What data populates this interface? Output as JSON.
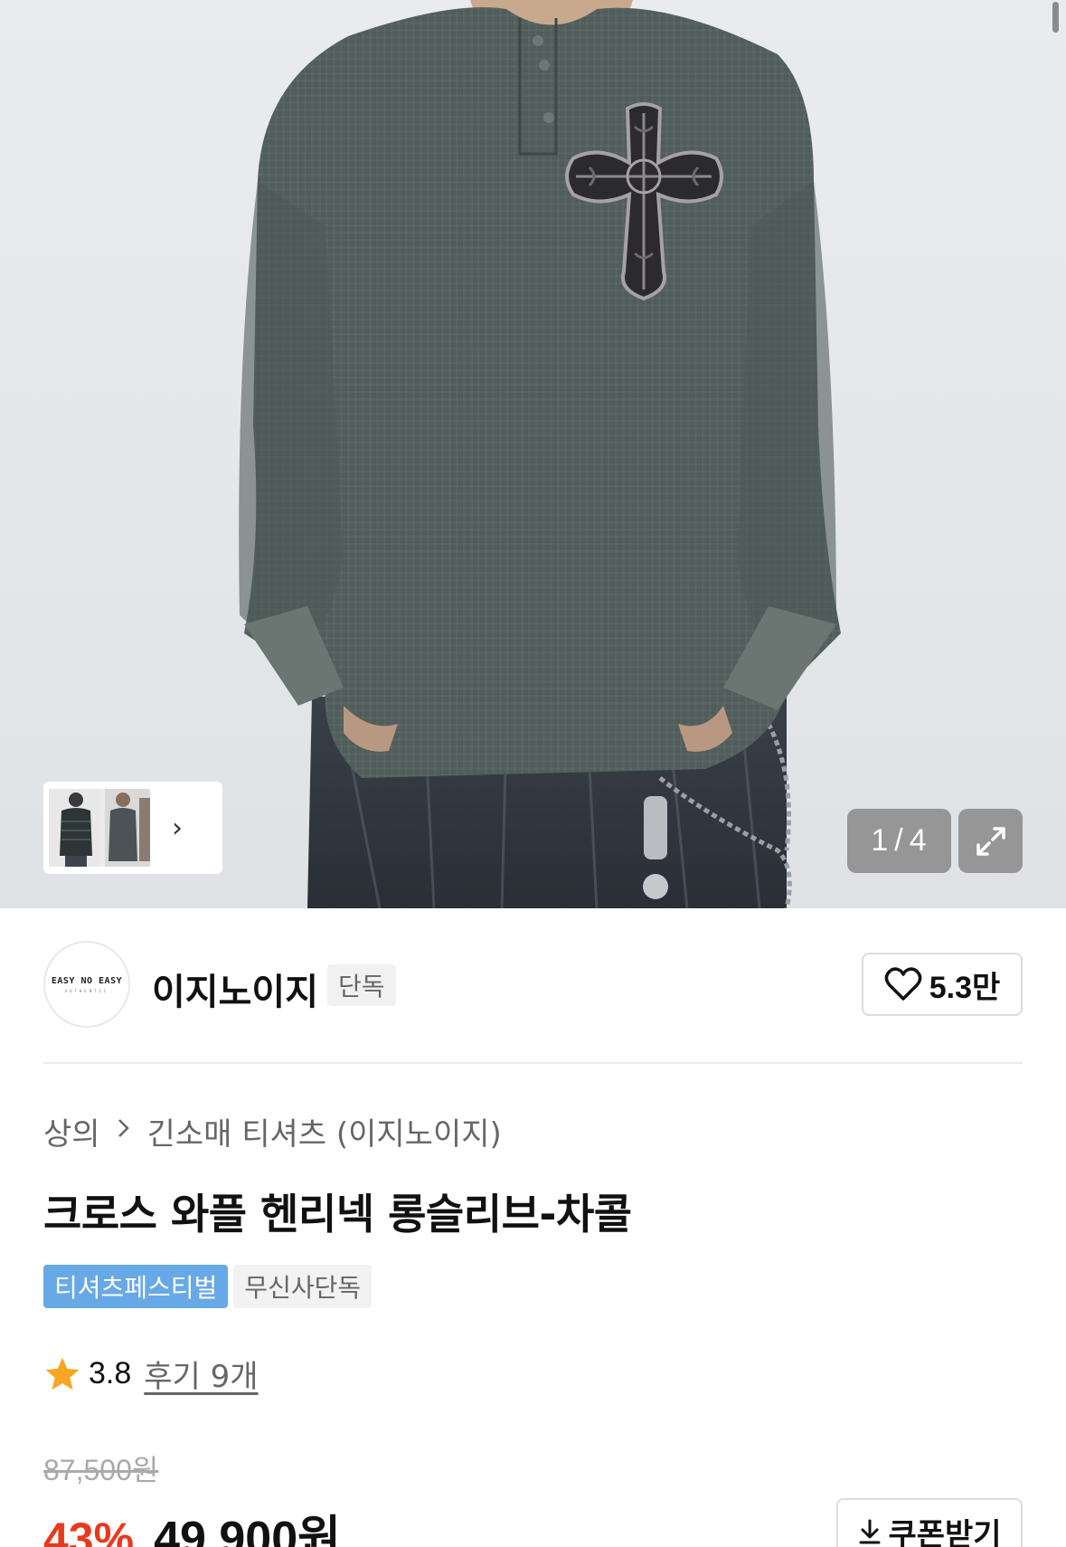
{
  "gallery": {
    "counter_current": "1",
    "counter_sep": "/",
    "counter_total": "4",
    "thumb_next_icon": "chevron-right-icon",
    "expand_icon": "expand-icon"
  },
  "brand": {
    "logo_text": "EASY NO EASY",
    "logo_subtext": "AUTHENTIC",
    "name": "이지노이지",
    "badge": "단독",
    "like_icon": "heart-outline-icon",
    "like_count": "5.3만"
  },
  "breadcrumb": {
    "category": "상의",
    "separator_icon": "chevron-right-icon",
    "subcategory": "긴소매 티셔츠 (이지노이지)"
  },
  "product": {
    "title": "크로스 와플 헨리넥 롱슬리브-차콜",
    "tags": [
      {
        "label": "티셔츠페스티벌",
        "style": "blue"
      },
      {
        "label": "무신사단독",
        "style": "gray"
      }
    ]
  },
  "rating": {
    "star_icon": "star-icon",
    "star_color": "#f5a623",
    "score": "3.8",
    "reviews_label": "후기 9개"
  },
  "price": {
    "original": "87,500원",
    "discount": "43%",
    "current": "49,900원",
    "discount_color": "#e8391e"
  },
  "coupon": {
    "icon": "download-icon",
    "label": "쿠폰받기"
  }
}
